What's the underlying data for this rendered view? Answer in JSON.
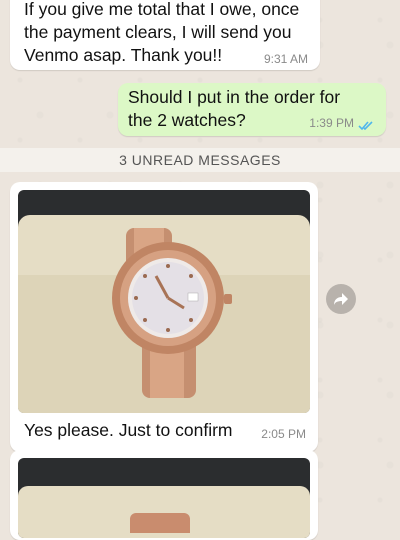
{
  "messages": [
    {
      "direction": "incoming",
      "text": "If you give me total that I owe, once the payment clears, I will send you Venmo asap. Thank you!!",
      "time": "9:31 AM"
    },
    {
      "direction": "outgoing",
      "text": "Should I put in the order for the 2 watches?",
      "time": "1:39 PM",
      "status": "read"
    },
    {
      "direction": "incoming",
      "type": "image",
      "caption": "Yes please.  Just to confirm",
      "time": "2:05 PM",
      "image": "rose-gold-watch-photo"
    },
    {
      "direction": "incoming",
      "type": "image",
      "image": "rose-gold-watch-photo-2"
    }
  ],
  "unread_banner": "3 UNREAD MESSAGES",
  "colors": {
    "background": "#ece5dd",
    "incoming_bubble": "#ffffff",
    "outgoing_bubble": "#dcf8c6",
    "read_ticks": "#4fb6ec"
  },
  "icons": {
    "forward": "forward-arrow-icon",
    "read_receipt": "double-check-icon"
  }
}
